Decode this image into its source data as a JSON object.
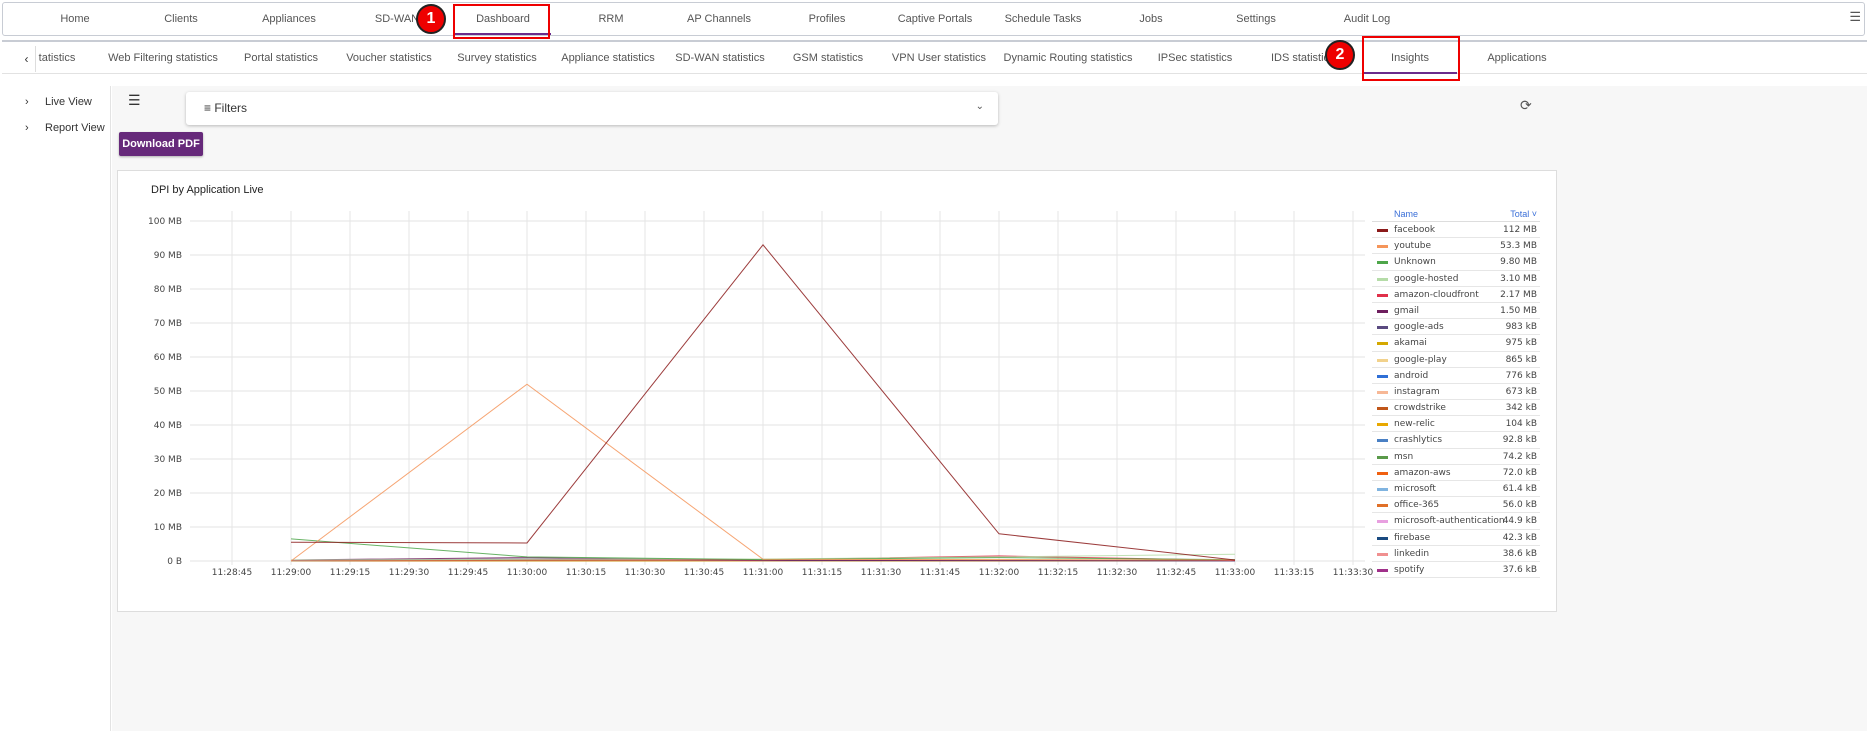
{
  "top_nav": [
    "Home",
    "Clients",
    "Appliances",
    "SD-WAN",
    "Dashboard",
    "RRM",
    "AP Channels",
    "Profiles",
    "Captive Portals",
    "Schedule Tasks",
    "Jobs",
    "Settings",
    "Audit Log"
  ],
  "top_nav_active": "Dashboard",
  "sub_nav": [
    "tatistics",
    "Web Filtering statistics",
    "Portal statistics",
    "Voucher statistics",
    "Survey statistics",
    "Appliance statistics",
    "SD-WAN statistics",
    "GSM statistics",
    "VPN User statistics",
    "Dynamic Routing statistics",
    "IPSec statistics",
    "IDS statistic",
    "Insights",
    "Applications"
  ],
  "sub_nav_active": "Insights",
  "badges": [
    "1",
    "2"
  ],
  "sidebar": [
    "Live View",
    "Report View"
  ],
  "filters_label": "Filters",
  "download_label": "Download PDF",
  "chart_data": {
    "type": "line",
    "title": "DPI by Application Live",
    "xlabel": "",
    "ylabel": "",
    "x_ticks": [
      "11:28:45",
      "11:29:00",
      "11:29:15",
      "11:29:30",
      "11:29:45",
      "11:30:00",
      "11:30:15",
      "11:30:30",
      "11:30:45",
      "11:31:00",
      "11:31:15",
      "11:31:30",
      "11:31:45",
      "11:32:00",
      "11:32:15",
      "11:32:30",
      "11:32:45",
      "11:33:00",
      "11:33:15",
      "11:33:30"
    ],
    "y_ticks": [
      "0 B",
      "10 MB",
      "20 MB",
      "30 MB",
      "40 MB",
      "50 MB",
      "60 MB",
      "70 MB",
      "80 MB",
      "90 MB",
      "100 MB"
    ],
    "ylim_mb": [
      0,
      100
    ],
    "x": [
      "11:29:00",
      "11:30:00",
      "11:31:00",
      "11:32:00",
      "11:33:00"
    ],
    "legend_header": {
      "name": "Name",
      "total": "Total ˅"
    },
    "series": [
      {
        "name": "facebook",
        "total": "112 MB",
        "color": "#8b1a1a",
        "values": [
          5.5,
          5.3,
          93,
          8,
          0.3
        ]
      },
      {
        "name": "youtube",
        "total": "53.3 MB",
        "color": "#f5955a",
        "values": [
          0,
          52,
          0.5,
          0.4,
          0.3
        ]
      },
      {
        "name": "Unknown",
        "total": "9.80 MB",
        "color": "#4ea64a",
        "values": [
          6.5,
          1.2,
          0.4,
          1.0,
          0.4
        ]
      },
      {
        "name": "google-hosted",
        "total": "3.10 MB",
        "color": "#b5dca8",
        "values": [
          0.3,
          0.5,
          0.6,
          1.2,
          2.0
        ]
      },
      {
        "name": "amazon-cloudfront",
        "total": "2.17 MB",
        "color": "#e0304a",
        "values": [
          0.2,
          0.3,
          0.3,
          1.5,
          0.2
        ]
      },
      {
        "name": "gmail",
        "total": "1.50 MB",
        "color": "#6e1e5e",
        "values": [
          0.3,
          1.0,
          0.2,
          0.1,
          0.1
        ]
      },
      {
        "name": "google-ads",
        "total": "983 kB",
        "color": "#5a4a80",
        "values": [
          0.2,
          0.6,
          0.1,
          0.1,
          0.0
        ]
      },
      {
        "name": "akamai",
        "total": "975 kB",
        "color": "#d4a800",
        "values": [
          0.1,
          0.2,
          0.2,
          0.3,
          0.2
        ]
      },
      {
        "name": "google-play",
        "total": "865 kB",
        "color": "#f2d28c",
        "values": [
          0.1,
          0.3,
          0.2,
          0.2,
          0.1
        ]
      },
      {
        "name": "android",
        "total": "776 kB",
        "color": "#2f6fd6",
        "values": [
          0.1,
          0.2,
          0.2,
          0.2,
          0.1
        ]
      },
      {
        "name": "instagram",
        "total": "673 kB",
        "color": "#f7b896",
        "values": [
          0.1,
          0.2,
          0.1,
          0.2,
          0.1
        ]
      },
      {
        "name": "crowdstrike",
        "total": "342 kB",
        "color": "#c0561a",
        "values": [
          0,
          0.1,
          0.1,
          0.1,
          0.1
        ]
      },
      {
        "name": "new-relic",
        "total": "104 kB",
        "color": "#e8a800",
        "values": [
          0,
          0,
          0,
          0,
          0
        ]
      },
      {
        "name": "crashlytics",
        "total": "92.8 kB",
        "color": "#4a80c4",
        "values": [
          0,
          0,
          0,
          0,
          0
        ]
      },
      {
        "name": "msn",
        "total": "74.2 kB",
        "color": "#5a9a4a",
        "values": [
          0,
          0,
          0,
          0,
          0
        ]
      },
      {
        "name": "amazon-aws",
        "total": "72.0 kB",
        "color": "#f06010",
        "values": [
          0,
          0,
          0,
          0,
          0
        ]
      },
      {
        "name": "microsoft",
        "total": "61.4 kB",
        "color": "#80b4e0",
        "values": [
          0,
          0,
          0,
          0,
          0
        ]
      },
      {
        "name": "office-365",
        "total": "56.0 kB",
        "color": "#e07028",
        "values": [
          0,
          0,
          0,
          0,
          0
        ]
      },
      {
        "name": "microsoft-authentication",
        "total": "44.9 kB",
        "color": "#e8a0e0",
        "values": [
          0,
          0,
          0,
          0,
          0
        ]
      },
      {
        "name": "firebase",
        "total": "42.3 kB",
        "color": "#1a4a80",
        "values": [
          0,
          0,
          0,
          0,
          0
        ]
      },
      {
        "name": "linkedin",
        "total": "38.6 kB",
        "color": "#f09090",
        "values": [
          0,
          0,
          0,
          0,
          0
        ]
      },
      {
        "name": "spotify",
        "total": "37.6 kB",
        "color": "#a0308a",
        "values": [
          0,
          0,
          0,
          0,
          0
        ]
      }
    ]
  }
}
